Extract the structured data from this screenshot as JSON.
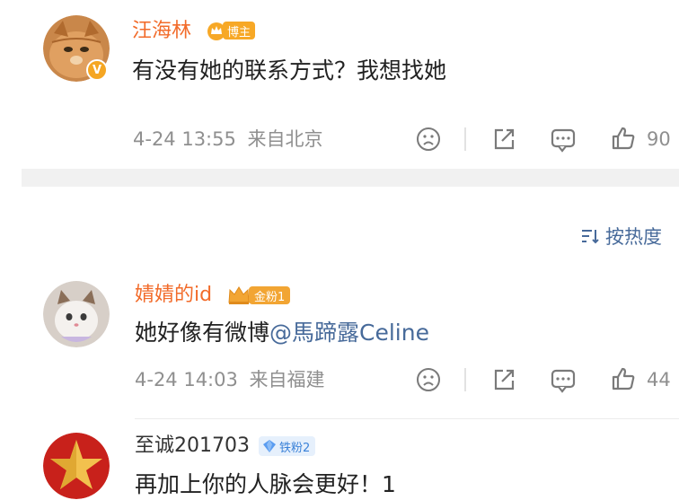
{
  "comments": [
    {
      "username": "汪海林",
      "username_color": "#f26b2a",
      "badge_label": "博主",
      "text": "有没有她的联系方式？我想找她",
      "time": "4-24 13:55",
      "location": "来自北京",
      "likes": "90",
      "avatar": "orange-cat-avatar",
      "verified": "V"
    },
    {
      "username": "婧婧的id",
      "username_color": "#f26b2a",
      "badge_label": "金粉1",
      "text": "她好像有微博",
      "mention": "@馬蹄露Celine",
      "time": "4-24 14:03",
      "location": "来自福建",
      "likes": "44",
      "avatar": "white-cat-avatar"
    },
    {
      "username": "至诚201703",
      "username_color": "#333333",
      "badge_label": "铁粉2",
      "text": "再加上你的人脉会更好！1",
      "avatar": "red-star-avatar"
    }
  ],
  "sort_label": "按热度",
  "colors": {
    "separator": "#f1f1f1",
    "meta": "#8f8f8f",
    "mention": "#476a9a",
    "accent_orange": "#f26b2a",
    "iron_fan_blue": "#5a9cf0"
  }
}
